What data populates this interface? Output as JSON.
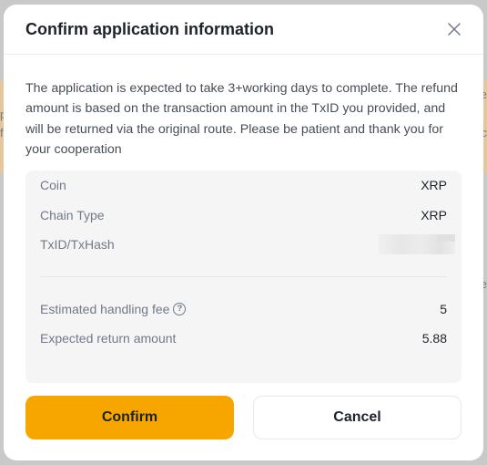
{
  "backdrop": {
    "left_chars": [
      "p",
      "f"
    ],
    "right_chars": [
      "e",
      "c",
      "e"
    ]
  },
  "modal": {
    "title": "Confirm application information",
    "close_icon": "close-icon",
    "notice": "The application is expected to take 3+working days to complete. The refund amount is based on the transaction amount in the TxID you provided, and will be returned via the original route. Please be patient and thank you for your cooperation",
    "details": {
      "coin": {
        "label": "Coin",
        "value": "XRP"
      },
      "chain_type": {
        "label": "Chain Type",
        "value": "XRP"
      },
      "txid": {
        "label": "TxID/TxHash"
      },
      "fee": {
        "label": "Estimated handling fee",
        "value": "5",
        "help_icon": "question-circle-icon",
        "help_glyph": "?"
      },
      "return_amount": {
        "label": "Expected return amount",
        "value": "5.88"
      }
    },
    "buttons": {
      "confirm": "Confirm",
      "cancel": "Cancel"
    }
  },
  "colors": {
    "accent": "#f7a600",
    "text_primary": "#1e2329",
    "text_secondary": "#707a8a"
  }
}
